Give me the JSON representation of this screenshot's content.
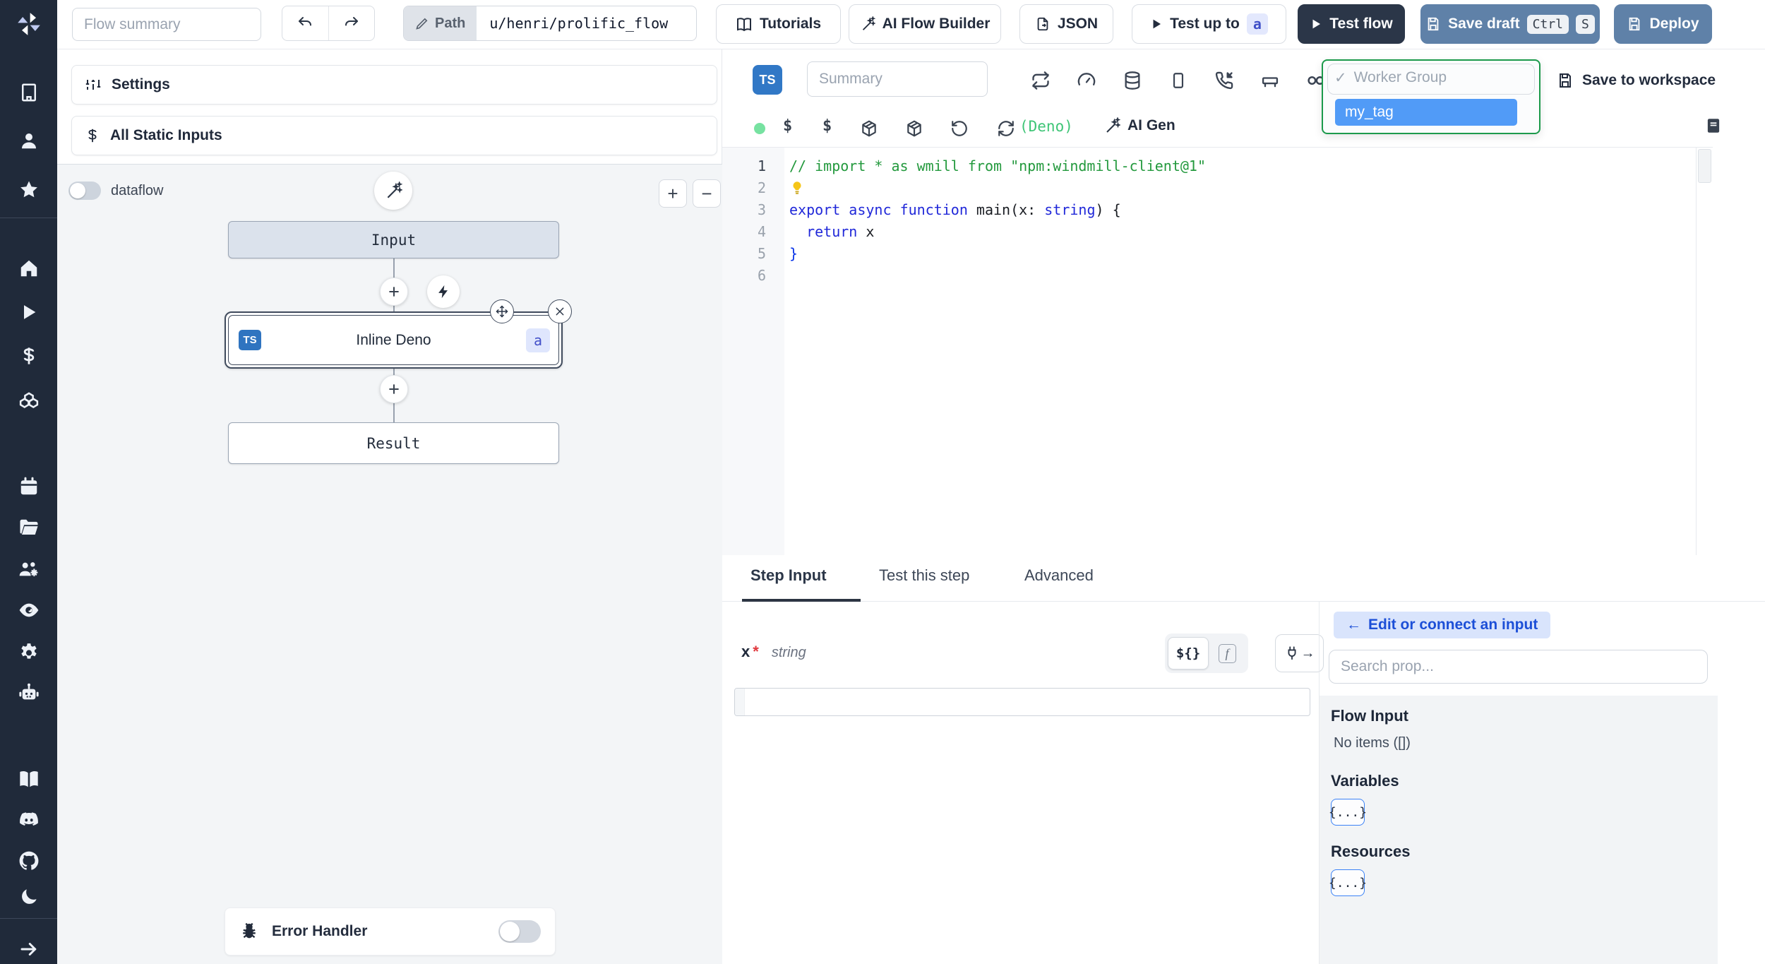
{
  "topbar": {
    "flow_summary_placeholder": "Flow summary",
    "path_label": "Path",
    "path_value": "u/henri/prolific_flow",
    "tutorials_label": "Tutorials",
    "ai_flow_builder_label": "AI Flow Builder",
    "json_label": "JSON",
    "test_up_to_label": "Test up to",
    "test_up_to_badge": "a",
    "test_flow_label": "Test flow",
    "save_draft_label": "Save draft",
    "save_draft_keys": {
      "k1": "Ctrl",
      "k2": "S"
    },
    "deploy_label": "Deploy"
  },
  "flow_panel": {
    "settings_label": "Settings",
    "static_inputs_label": "All Static Inputs",
    "dataflow_label": "dataflow",
    "input_node": "Input",
    "step_node": {
      "lang_badge": "TS",
      "title": "Inline Deno",
      "id_badge": "a"
    },
    "result_node": "Result",
    "error_handler_label": "Error Handler"
  },
  "editor": {
    "lang_badge": "TS",
    "summary_placeholder": "Summary",
    "status": {
      "lang": "(Deno)",
      "ai_gen_label": "AI Gen"
    },
    "worker_group": {
      "check": "✓",
      "label": "Worker Group",
      "selected_tag": "my_tag"
    },
    "save_to_workspace_label": "Save to workspace",
    "code": {
      "line_numbers": [
        "1",
        "2",
        "3",
        "4",
        "5",
        "6"
      ],
      "lines": [
        {
          "segments": [
            {
              "text": "// import * as wmill from \"npm:windmill-client@1\"",
              "style": "comment"
            }
          ]
        },
        {
          "segments": [
            {
              "icon": "lightbulb"
            }
          ]
        },
        {
          "segments": [
            {
              "text": "export",
              "style": "keyword"
            },
            {
              "text": " ",
              "style": "plain"
            },
            {
              "text": "async",
              "style": "keyword"
            },
            {
              "text": " ",
              "style": "plain"
            },
            {
              "text": "function",
              "style": "keyword"
            },
            {
              "text": " main(x: ",
              "style": "plain"
            },
            {
              "text": "string",
              "style": "keyword"
            },
            {
              "text": ") {",
              "style": "plain"
            }
          ]
        },
        {
          "segments": [
            {
              "text": "  ",
              "style": "plain"
            },
            {
              "text": "return",
              "style": "keyword"
            },
            {
              "text": " x",
              "style": "plain"
            }
          ]
        },
        {
          "segments": [
            {
              "text": "}",
              "style": "bracket"
            }
          ]
        },
        {
          "segments": []
        }
      ]
    }
  },
  "step_panel": {
    "tabs": [
      {
        "label": "Step Input"
      },
      {
        "label": "Test this step"
      },
      {
        "label": "Advanced"
      }
    ],
    "arg": {
      "name": "x",
      "required_mark": "*",
      "type": "string"
    },
    "toggle": {
      "templated": "${}",
      "fx": "f"
    },
    "connect_pill_label": "Edit or connect an input",
    "search_placeholder": "Search prop...",
    "flow_input_title": "Flow Input",
    "flow_input_empty": "No items ([])",
    "variables_title": "Variables",
    "resources_title": "Resources",
    "braces": "{...}"
  },
  "icons": {
    "plus": "+",
    "minus": "−",
    "arrow_left": "←",
    "arrow_right": "→"
  }
}
